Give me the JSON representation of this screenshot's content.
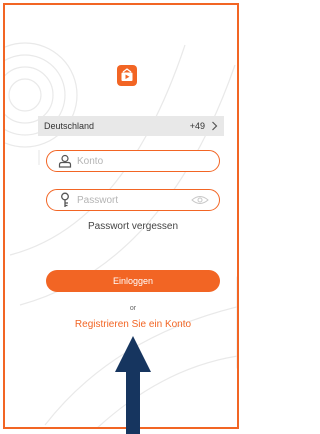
{
  "app": {
    "logo_icon": "play-video-icon",
    "accent_color": "#f26524"
  },
  "country": {
    "name": "Deutschland",
    "dial_code": "+49",
    "chevron_icon": "chevron-right-icon"
  },
  "account": {
    "placeholder": "Konto",
    "value": "",
    "icon": "user-icon"
  },
  "password": {
    "placeholder": "Passwort",
    "value": "",
    "icon": "key-icon",
    "toggle_icon": "eye-icon"
  },
  "forgot_password_label": "Passwort vergessen",
  "login_label": "Einloggen",
  "or_label": "or",
  "register_label": "Registrieren Sie ein Konto",
  "annotation": {
    "icon": "up-arrow-icon",
    "color": "#16355f"
  }
}
